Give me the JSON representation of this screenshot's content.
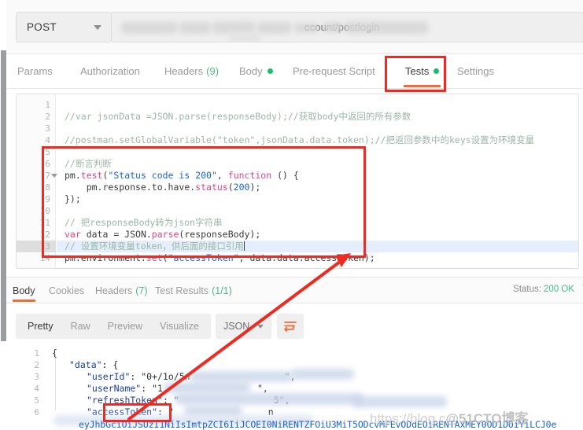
{
  "request": {
    "method": "POST",
    "url_visible_suffix": "ccount/postlogin"
  },
  "request_tabs": [
    {
      "label": "Params",
      "active": false,
      "count": null,
      "dot": false
    },
    {
      "label": "Authorization",
      "active": false,
      "count": null,
      "dot": false
    },
    {
      "label": "Headers",
      "active": false,
      "count": "(9)",
      "dot": false
    },
    {
      "label": "Body",
      "active": false,
      "count": null,
      "dot": true
    },
    {
      "label": "Pre-request Script",
      "active": false,
      "count": null,
      "dot": false
    },
    {
      "label": "Tests",
      "active": true,
      "count": null,
      "dot": true
    },
    {
      "label": "Settings",
      "active": false,
      "count": null,
      "dot": false
    }
  ],
  "editor": {
    "line_numbers": [
      "1",
      "2",
      "3",
      "4",
      "5",
      "6",
      "7",
      "8",
      "9",
      "10",
      "11",
      "12",
      "13",
      "14"
    ],
    "current_line": 13,
    "lines": [
      "",
      "//var jsonData =JSON.parse(responseBody);//获取body中返回的所有参数",
      "",
      "//postman.setGlobalVariable(\"token\",jsonData.data.token);//把返回参数中的keys设置为环境变量",
      "",
      "//断言判断",
      "pm.test(\"Status code is 200\", function () {",
      "    pm.response.to.have.status(200);",
      "});",
      "",
      "// 把responseBody转为json字符串",
      "var data = JSON.parse(responseBody);",
      "// 设置环境变量token，供后面的接口引用",
      "pm.environment.set(\"accessToken\", data.data.accessToken);"
    ]
  },
  "response_tabs": [
    {
      "label": "Body",
      "active": true,
      "count": null
    },
    {
      "label": "Cookies",
      "active": false,
      "count": null
    },
    {
      "label": "Headers",
      "active": false,
      "count": "(7)"
    },
    {
      "label": "Test Results",
      "active": false,
      "count": "(1/1)"
    }
  ],
  "response_status": {
    "label": "Status:",
    "value": "200 OK",
    "extra": "T"
  },
  "body_toolbar": {
    "segments": [
      {
        "label": "Pretty",
        "active": true
      },
      {
        "label": "Raw",
        "active": false
      },
      {
        "label": "Preview",
        "active": false
      },
      {
        "label": "Visualize",
        "active": false
      }
    ],
    "format_selected": "JSON",
    "wrap_icon": "wrap-lines-icon"
  },
  "json_body": {
    "line_numbers": [
      "1",
      "2",
      "3",
      "4",
      "5",
      "6"
    ],
    "lines": [
      {
        "indent": 0,
        "text": "{"
      },
      {
        "indent": 1,
        "key": "\"data\"",
        "text": ": {"
      },
      {
        "indent": 2,
        "key": "\"userId\"",
        "text": ": \"0+/1o/5n",
        "tail": "\","
      },
      {
        "indent": 2,
        "key": "\"userName\"",
        "text": ": \"1",
        "tail": "\","
      },
      {
        "indent": 2,
        "key": "\"refreshToken\"",
        "text": ": \"",
        "tail": "5\","
      },
      {
        "indent": 2,
        "key": "\"accessToken\"",
        "text": ": \"",
        "tail": "n"
      }
    ],
    "jwt_fragment": "eyJhbGciOiJSUzI1NiIsImtpZCI6IiJCOEI0NiRENTZFOiU3MiT5ODcvMFEvODdEOiRENTAxMEY0OD1DOiYiLCJ0e"
  },
  "annotations": {
    "boxes": [
      {
        "name": "tests-tab-highlight",
        "color": "#ee2b23"
      },
      {
        "name": "code-block-highlight",
        "color": "#ee2b23"
      },
      {
        "name": "access-token-highlight",
        "color": "#ee2b23"
      }
    ],
    "arrow": {
      "name": "token-link-arrow",
      "color": "#ee2b23"
    }
  },
  "watermark": {
    "prefix": "https://blog.c",
    "brand": "@51CTO博客"
  },
  "colors": {
    "accent_orange": "#f26b3a",
    "status_green": "#3fbf7f",
    "dot_green": "#1bbd6c",
    "annotation_red": "#ee2b23"
  }
}
